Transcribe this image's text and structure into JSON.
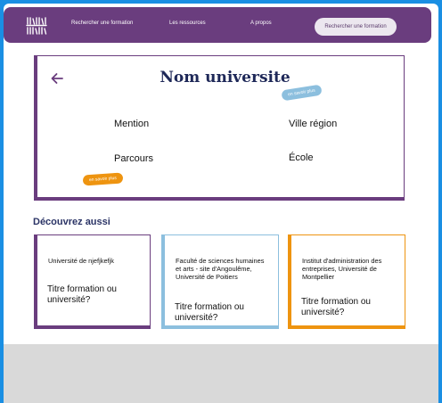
{
  "header": {
    "logo_icon": "books-logo-icon",
    "nav": [
      {
        "label": "Rechercher une formation"
      },
      {
        "label": "Les ressources"
      },
      {
        "label": "A propos"
      }
    ],
    "cta_label": "Rechercher une formation"
  },
  "university": {
    "back_icon": "arrow-left-icon",
    "title": "Nom universite",
    "more_blue": "en savoir plus",
    "more_orange": "en savoir plus",
    "mention": "Mention",
    "parcours": "Parcours",
    "ville_region": "Ville région",
    "ecole": "École"
  },
  "discover": {
    "title": "Découvrez aussi",
    "cards": [
      {
        "name": "Université de njefjkefjk",
        "subtitle": "Titre formation ou université?",
        "color": "#6a3d7e"
      },
      {
        "name": "Faculté de sciences humaines et arts - site d'Angoulême, Université de Poitiers",
        "subtitle": "Titre formation ou université?",
        "color": "#8cbfde"
      },
      {
        "name": "Institut d'administration des entreprises, Université de Montpellier",
        "subtitle": "Titre formation ou université?",
        "color": "#ee9410"
      }
    ]
  },
  "colors": {
    "primary": "#6a3d7e",
    "accent_blue": "#8cbfde",
    "accent_orange": "#ee9410",
    "title_navy": "#1e2858"
  }
}
